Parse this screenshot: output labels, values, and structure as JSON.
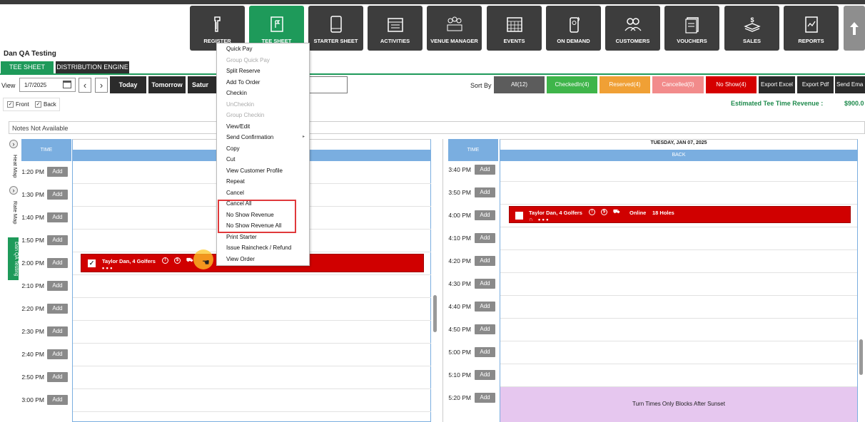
{
  "nav": {
    "buttons": [
      {
        "label": "REGISTER",
        "icon": "barcode-scanner-icon"
      },
      {
        "label": "TEE SHEET",
        "icon": "flag-sheet-icon"
      },
      {
        "label": "STARTER SHEET",
        "icon": "tablet-icon"
      },
      {
        "label": "ACTIVITIES",
        "icon": "calendar-list-icon"
      },
      {
        "label": "VENUE MANAGER",
        "icon": "venue-people-icon"
      },
      {
        "label": "EVENTS",
        "icon": "calendar-grid-icon"
      },
      {
        "label": "ON DEMAND",
        "icon": "phone-signal-icon"
      },
      {
        "label": "CUSTOMERS",
        "icon": "customers-icon"
      },
      {
        "label": "VOUCHERS",
        "icon": "vouchers-icon"
      },
      {
        "label": "SALES",
        "icon": "sales-money-icon"
      },
      {
        "label": "REPORTS",
        "icon": "report-chart-icon"
      }
    ],
    "active_color": "#1e9a5a"
  },
  "site_title": "Dan QA Testing",
  "tabs": {
    "tee_sheet": "TEE SHEET",
    "distribution": "DISTRIBUTION ENGINE"
  },
  "toolbar": {
    "view_label": "View",
    "date_value": "1/7/2025",
    "today": "Today",
    "tomorrow": "Tomorrow",
    "saturday": "Satur",
    "sort_by": "Sort By",
    "sort_buttons": [
      {
        "label": "All(12)",
        "color": "#5c5c5c"
      },
      {
        "label": "CheckedIn(4)",
        "color": "#3fb54a"
      },
      {
        "label": "Reserved(4)",
        "color": "#f0a035"
      },
      {
        "label": "Cancelled(0)",
        "color": "#f28b8b"
      },
      {
        "label": "No Show(4)",
        "color": "#d50000"
      }
    ],
    "export_excel": "Export Excel",
    "export_pdf": "Export Pdf",
    "send_email": "Send Ema"
  },
  "filters": {
    "front": "Front",
    "back": "Back"
  },
  "revenue": {
    "label": "Estimated Tee Time Revenue :",
    "value": "$900.0"
  },
  "notes": "Notes Not Available",
  "side": {
    "heat_map": "Heat Map",
    "rate_map": "Rate Map",
    "testing": "Dan QA Testing"
  },
  "left_panel": {
    "time_header": "TIME",
    "add_label": "Add",
    "times": [
      "1:20 PM",
      "1:30 PM",
      "1:40 PM",
      "1:50 PM",
      "2:00 PM",
      "2:10 PM",
      "2:20 PM",
      "2:30 PM",
      "2:40 PM",
      "2:50 PM",
      "3:00 PM"
    ],
    "booking": {
      "name": "Taylor Dan, 4 Golfers",
      "check": "✓",
      "dots": "• • •"
    }
  },
  "right_panel": {
    "date_header": "TUESDAY, JAN 07, 2025",
    "course": "BACK",
    "time_header": "TIME",
    "add_label": "Add",
    "times": [
      "3:40 PM",
      "3:50 PM",
      "4:00 PM",
      "4:10 PM",
      "4:20 PM",
      "4:30 PM",
      "4:40 PM",
      "4:50 PM",
      "5:00 PM",
      "5:10 PM",
      "5:20 PM"
    ],
    "booking": {
      "name": "Taylor Dan, 4 Golfers",
      "channel": "Online",
      "holes": "18 Holes",
      "dots": "• • •"
    },
    "sunset_block": "Turn Times Only Blocks After Sunset"
  },
  "context_menu": {
    "items": [
      {
        "label": "Quick Pay",
        "enabled": true
      },
      {
        "label": "Group Quick Pay",
        "enabled": false
      },
      {
        "label": "Split Reserve",
        "enabled": true
      },
      {
        "label": "Add To Order",
        "enabled": true
      },
      {
        "label": "Checkin",
        "enabled": true
      },
      {
        "label": "UnCheckin",
        "enabled": false
      },
      {
        "label": "Group Checkin",
        "enabled": false
      },
      {
        "label": "View/Edit",
        "enabled": true
      },
      {
        "label": "Send Confirmation",
        "enabled": true
      },
      {
        "label": "Copy",
        "enabled": true
      },
      {
        "label": "Cut",
        "enabled": true
      },
      {
        "label": "View Customer Profile",
        "enabled": true
      },
      {
        "label": "Repeat",
        "enabled": true
      },
      {
        "label": "Cancel",
        "enabled": true
      },
      {
        "label": "Cancel All",
        "enabled": true
      },
      {
        "label": "No Show Revenue",
        "enabled": true
      },
      {
        "label": "No Show Revenue All",
        "enabled": true
      },
      {
        "label": "Print Starter",
        "enabled": true
      },
      {
        "label": "Issue Raincheck / Refund",
        "enabled": true
      },
      {
        "label": "View Order",
        "enabled": true
      }
    ],
    "highlight_color": "#e0393b"
  }
}
